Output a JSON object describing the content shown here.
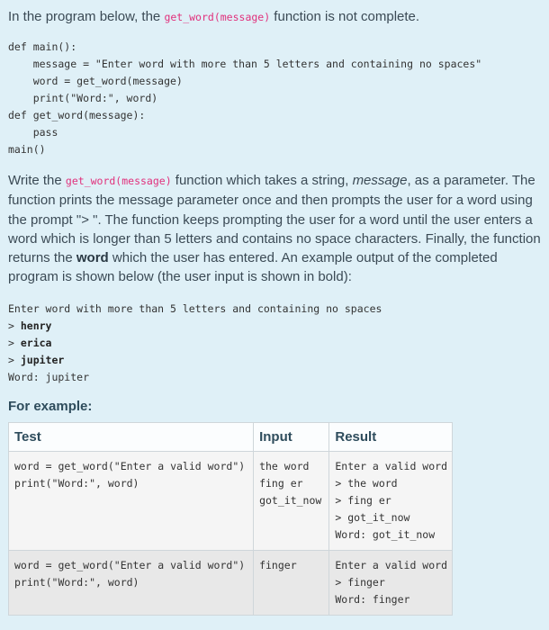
{
  "intro": {
    "before": "In the program below, the ",
    "code": "get_word(message)",
    "after": " function is not complete."
  },
  "program_code": "def main():\n    message = \"Enter word with more than 5 letters and containing no spaces\"\n    word = get_word(message)\n    print(\"Word:\", word)\ndef get_word(message):\n    pass\nmain()",
  "description": {
    "part1": "Write the ",
    "code": "get_word(message)",
    "part2": " function which takes a string, ",
    "emph": "message",
    "part3": ", as a parameter. The function prints the message parameter once and then prompts the user for a word using the prompt \"> \". The function keeps prompting the user for a word until the user enters a word which is longer than 5 letters and contains no space characters. Finally, the function returns the ",
    "bold": "word",
    "part4": " which the user has entered. An example output of the completed program is shown below (the user input is shown in bold):"
  },
  "sample_output": {
    "first_line": "Enter word with more than 5 letters and containing no spaces",
    "inputs": [
      {
        "prompt": "> ",
        "value": "henry"
      },
      {
        "prompt": "> ",
        "value": "erica"
      },
      {
        "prompt": "> ",
        "value": "jupiter"
      }
    ],
    "last_line": "Word: jupiter"
  },
  "example_heading": "For example:",
  "table": {
    "headers": [
      "Test",
      "Input",
      "Result"
    ],
    "rows": [
      {
        "test": "word = get_word(\"Enter a valid word\")\nprint(\"Word:\", word)",
        "input": "the word\nfing er\ngot_it_now",
        "result": "Enter a valid word\n> the word\n> fing er\n> got_it_now\nWord: got_it_now"
      },
      {
        "test": "word = get_word(\"Enter a valid word\")\nprint(\"Word:\", word)",
        "input": "finger",
        "result": "Enter a valid word\n> finger\nWord: finger"
      }
    ]
  }
}
